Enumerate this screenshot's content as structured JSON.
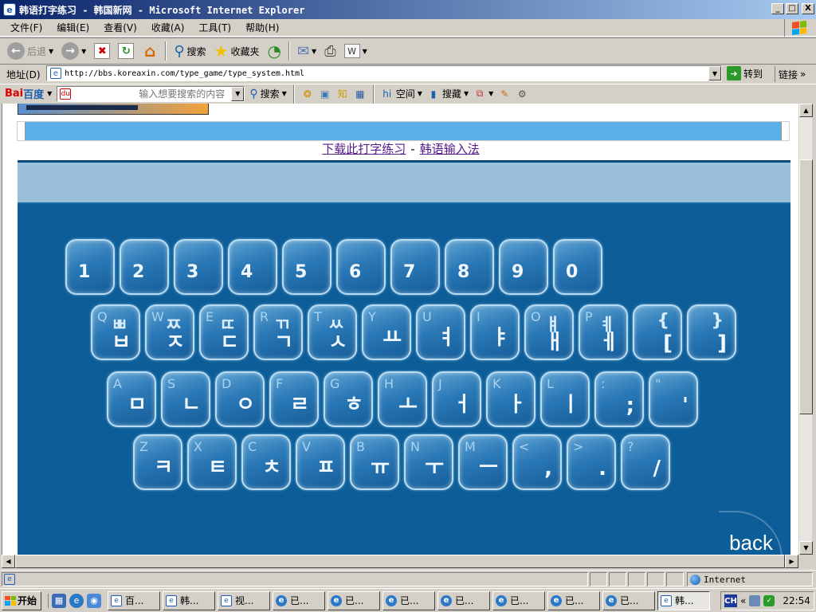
{
  "window": {
    "title": "韩语打字练习 - 韩国新网 - Microsoft Internet Explorer",
    "controls": {
      "minimize": "_",
      "maximize": "□",
      "close": "X"
    }
  },
  "menu": [
    "文件(F)",
    "编辑(E)",
    "查看(V)",
    "收藏(A)",
    "工具(T)",
    "帮助(H)"
  ],
  "toolbar": {
    "back_label": "后退",
    "search_label": "搜索",
    "favorites_label": "收藏夹"
  },
  "address": {
    "label": "地址(D)",
    "url": "http://bbs.koreaxin.com/type_game/type_system.html",
    "go_label": "转到",
    "links_label": "链接"
  },
  "baidu": {
    "logo_red": "Bai",
    "logo_blue": "百度",
    "search_placeholder": "输入想要搜索的内容",
    "search_btn": "搜索",
    "zhidao_label": "知",
    "space_label": "空间",
    "collect_label": "搜藏"
  },
  "page": {
    "link_download": "下载此打字练习",
    "separator": "-",
    "link_ime": "韩语输入法",
    "back_label": "back",
    "keyboard": {
      "row1": [
        {
          "lat": "",
          "han": "1"
        },
        {
          "lat": "",
          "han": "2"
        },
        {
          "lat": "",
          "han": "3"
        },
        {
          "lat": "",
          "han": "4"
        },
        {
          "lat": "",
          "han": "5"
        },
        {
          "lat": "",
          "han": "6"
        },
        {
          "lat": "",
          "han": "7"
        },
        {
          "lat": "",
          "han": "8"
        },
        {
          "lat": "",
          "han": "9"
        },
        {
          "lat": "",
          "han": "0"
        }
      ],
      "row2": [
        {
          "lat": "Q",
          "top": "ㅃ",
          "han": "ㅂ"
        },
        {
          "lat": "W",
          "top": "ㅉ",
          "han": "ㅈ"
        },
        {
          "lat": "E",
          "top": "ㄸ",
          "han": "ㄷ"
        },
        {
          "lat": "R",
          "top": "ㄲ",
          "han": "ㄱ"
        },
        {
          "lat": "T",
          "top": "ㅆ",
          "han": "ㅅ"
        },
        {
          "lat": "Y",
          "top": "",
          "han": "ㅛ"
        },
        {
          "lat": "U",
          "top": "",
          "han": "ㅕ"
        },
        {
          "lat": "I",
          "top": "",
          "han": "ㅑ"
        },
        {
          "lat": "O",
          "top": "ㅒ",
          "han": "ㅐ"
        },
        {
          "lat": "P",
          "top": "ㅖ",
          "han": "ㅔ"
        },
        {
          "lat": "",
          "top": "{",
          "han": "["
        },
        {
          "lat": "",
          "top": "}",
          "han": "]"
        }
      ],
      "row3": [
        {
          "lat": "A",
          "han": "ㅁ"
        },
        {
          "lat": "S",
          "han": "ㄴ"
        },
        {
          "lat": "D",
          "han": "ㅇ"
        },
        {
          "lat": "F",
          "han": "ㄹ"
        },
        {
          "lat": "G",
          "han": "ㅎ"
        },
        {
          "lat": "H",
          "han": "ㅗ"
        },
        {
          "lat": "J",
          "han": "ㅓ"
        },
        {
          "lat": "K",
          "han": "ㅏ"
        },
        {
          "lat": "L",
          "han": "ㅣ"
        },
        {
          "lat": ":",
          "han": ";"
        },
        {
          "lat": "\"",
          "han": "'"
        }
      ],
      "row4": [
        {
          "lat": "Z",
          "han": "ㅋ"
        },
        {
          "lat": "X",
          "han": "ㅌ"
        },
        {
          "lat": "C",
          "han": "ㅊ"
        },
        {
          "lat": "V",
          "han": "ㅍ"
        },
        {
          "lat": "B",
          "han": "ㅠ"
        },
        {
          "lat": "N",
          "han": "ㅜ"
        },
        {
          "lat": "M",
          "han": "ㅡ"
        },
        {
          "lat": "<",
          "han": ","
        },
        {
          "lat": ">",
          "han": "."
        },
        {
          "lat": "?",
          "han": "/"
        }
      ]
    }
  },
  "status": {
    "zone": "Internet"
  },
  "taskbar": {
    "start": "开始",
    "tasks": [
      {
        "label": "百...",
        "icon": "doc",
        "active": false
      },
      {
        "label": "韩...",
        "icon": "doc",
        "active": false
      },
      {
        "label": "视...",
        "icon": "doc",
        "active": false
      },
      {
        "label": "已...",
        "icon": "ie",
        "active": false
      },
      {
        "label": "已...",
        "icon": "ie",
        "active": false
      },
      {
        "label": "已...",
        "icon": "ie",
        "active": false
      },
      {
        "label": "已...",
        "icon": "ie",
        "active": false
      },
      {
        "label": "已...",
        "icon": "ie",
        "active": false
      },
      {
        "label": "已...",
        "icon": "ie",
        "active": false
      },
      {
        "label": "已...",
        "icon": "ie",
        "active": false
      },
      {
        "label": "韩...",
        "icon": "doc",
        "active": true
      }
    ],
    "tray_ime": "CH",
    "tray_chevron": "«",
    "clock": "22:54"
  }
}
